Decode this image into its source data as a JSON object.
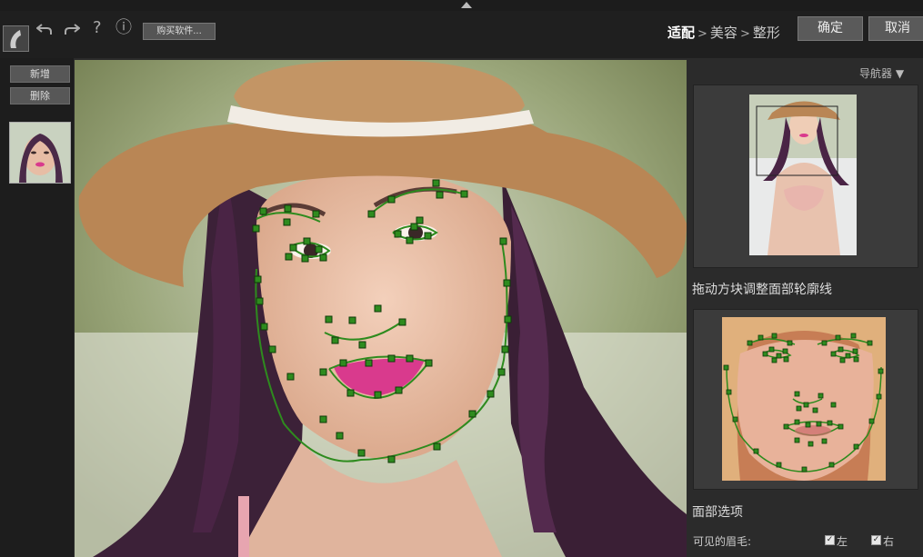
{
  "toolbar": {
    "undo_icon": "undo-icon",
    "redo_icon": "redo-icon",
    "help_label": "?",
    "info_label": "ⓘ",
    "buy_label": "购买软件..."
  },
  "breadcrumb": {
    "step1": "适配",
    "sep": ">",
    "step2": "美容",
    "step3": "整形"
  },
  "buttons": {
    "confirm": "确定",
    "cancel": "取消",
    "add": "新增",
    "delete": "删除"
  },
  "navigator": {
    "title": "导航器 ▼"
  },
  "sections": {
    "drag_hint": "拖动方块调整面部轮廓线",
    "face_options": "面部选项"
  },
  "options": {
    "eyebrow_label": "可见的眉毛:",
    "left_label": "左",
    "right_label": "右",
    "left_checked": true,
    "right_checked": true
  },
  "colors": {
    "marker": "#2e8b1e",
    "lipstick": "#d93a8d",
    "hat": "#b98655"
  }
}
